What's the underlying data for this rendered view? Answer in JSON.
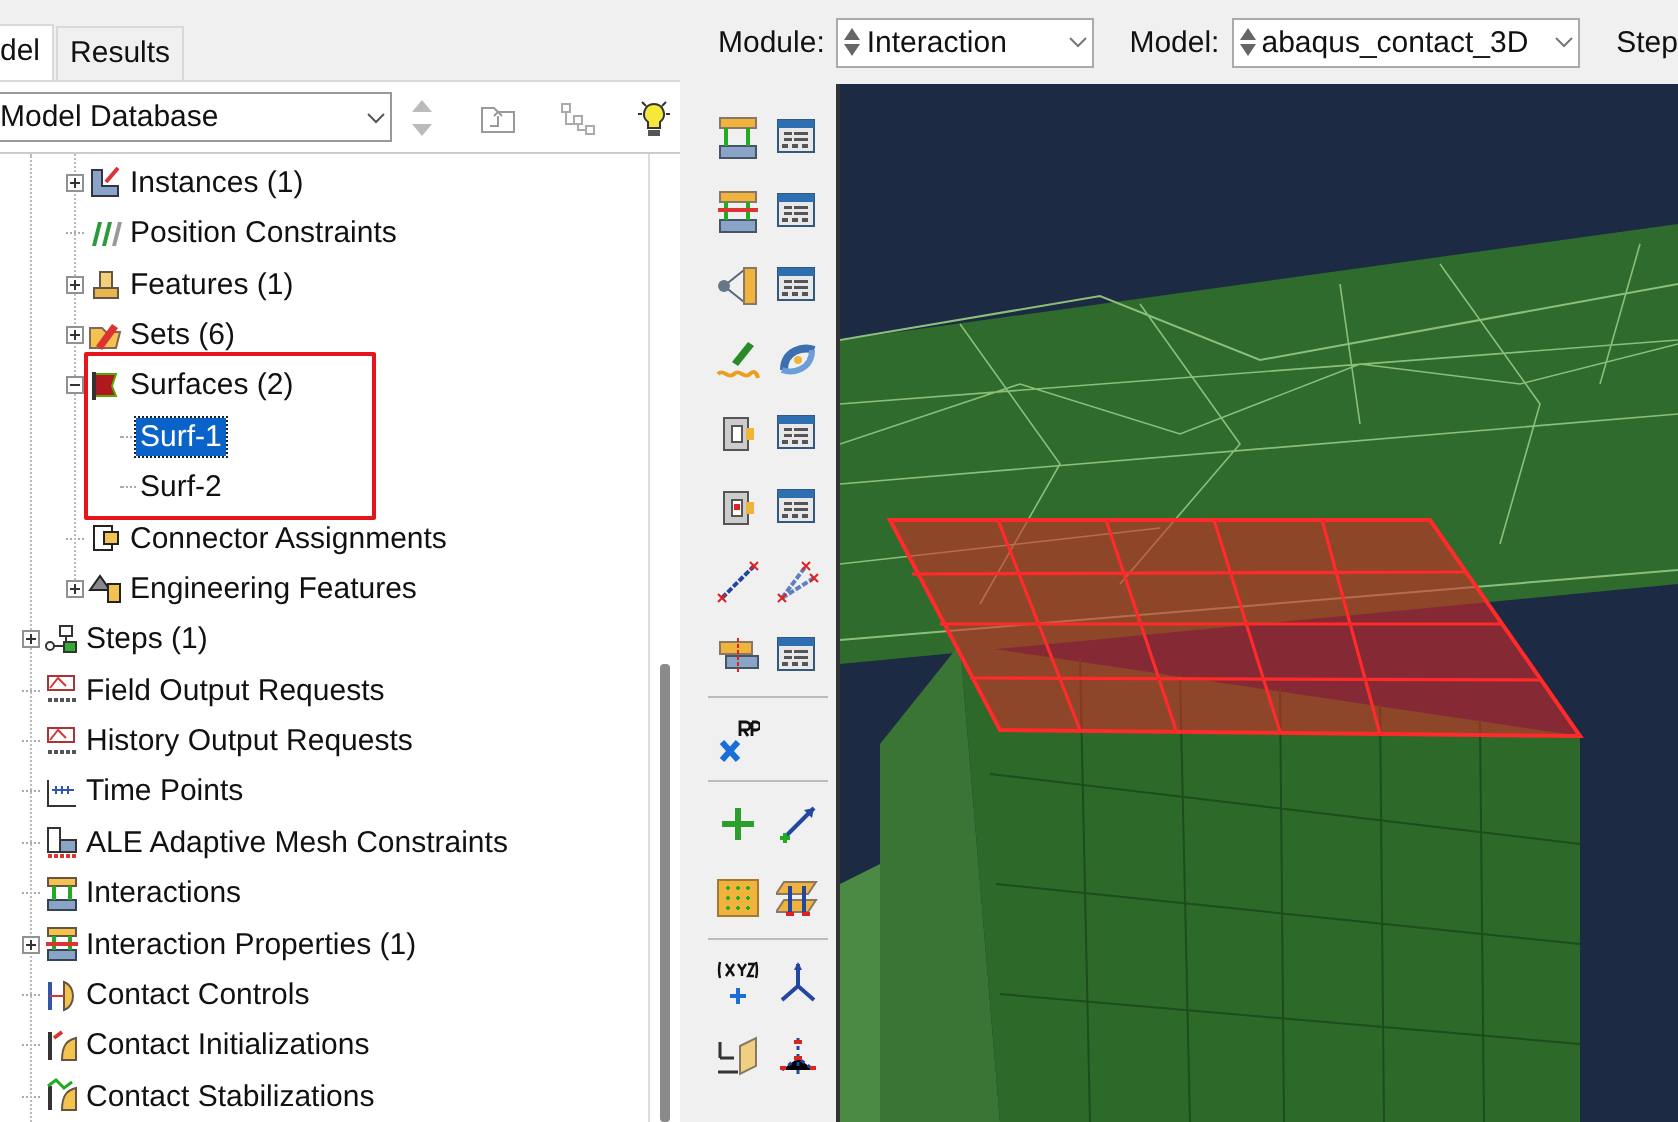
{
  "tabs": [
    {
      "label": "del",
      "selected": true
    },
    {
      "label": "Results",
      "selected": false
    }
  ],
  "tree_selector": {
    "value": "Model Database"
  },
  "tree": {
    "continued_children": [
      {
        "label": "Instances (1)",
        "kind": "group",
        "expanded": false,
        "selected": false
      },
      {
        "label": "Position Constraints",
        "kind": "leaf",
        "selected": false
      },
      {
        "label": "Features (1)",
        "kind": "group",
        "expanded": false,
        "selected": false
      },
      {
        "label": "Sets (6)",
        "kind": "group",
        "expanded": false,
        "selected": false
      },
      {
        "label": "Surfaces (2)",
        "kind": "group",
        "expanded": true,
        "selected": false,
        "children": [
          {
            "label": "Surf-1",
            "selected": true
          },
          {
            "label": "Surf-2",
            "selected": false
          }
        ]
      },
      {
        "label": "Connector Assignments",
        "kind": "leaf",
        "selected": false
      },
      {
        "label": "Engineering Features",
        "kind": "group",
        "expanded": false,
        "selected": false
      }
    ],
    "items": [
      {
        "label": "Steps (1)",
        "kind": "group",
        "expanded": false,
        "selected": false
      },
      {
        "label": "Field Output Requests",
        "kind": "leaf",
        "selected": false
      },
      {
        "label": "History Output Requests",
        "kind": "leaf",
        "selected": false
      },
      {
        "label": "Time Points",
        "kind": "leaf",
        "selected": false
      },
      {
        "label": "ALE Adaptive Mesh Constraints",
        "kind": "leaf",
        "selected": false
      },
      {
        "label": "Interactions",
        "kind": "leaf",
        "selected": false
      },
      {
        "label": "Interaction Properties (1)",
        "kind": "group",
        "expanded": false,
        "selected": false
      },
      {
        "label": "Contact Controls",
        "kind": "leaf",
        "selected": false
      },
      {
        "label": "Contact Initializations",
        "kind": "leaf",
        "selected": false
      },
      {
        "label": "Contact Stabilizations",
        "kind": "leaf",
        "selected": false
      }
    ]
  },
  "top_bar": {
    "module": {
      "label": "Module:",
      "value": "Interaction"
    },
    "model": {
      "label": "Model:",
      "value": "abaqus_contact_3D"
    },
    "step_label": "Step"
  }
}
